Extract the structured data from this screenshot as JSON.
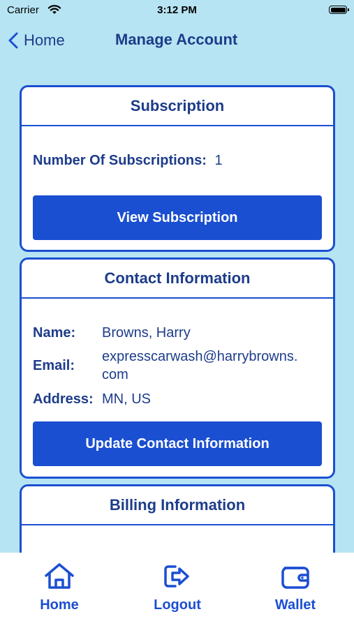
{
  "status_bar": {
    "carrier": "Carrier",
    "time": "3:12 PM"
  },
  "nav": {
    "back_label": "Home",
    "title": "Manage Account"
  },
  "subscription": {
    "title": "Subscription",
    "count_label": "Number Of Subscriptions:",
    "count_value": "1",
    "button_label": "View Subscription"
  },
  "contact": {
    "title": "Contact Information",
    "name_label": "Name:",
    "name_value": "Browns, Harry",
    "email_label": "Email:",
    "email_value_line1": "expresscarwash@harrybrowns.",
    "email_value_line2": "com",
    "address_label": "Address:",
    "address_value": "MN, US",
    "button_label": "Update Contact Information"
  },
  "billing": {
    "title": "Billing Information"
  },
  "tabs": [
    {
      "label": "Home",
      "icon": "home-icon"
    },
    {
      "label": "Logout",
      "icon": "logout-icon"
    },
    {
      "label": "Wallet",
      "icon": "wallet-icon"
    }
  ],
  "colors": {
    "background": "#b7e4f3",
    "accent": "#1b4fd1",
    "text": "#1d3c8a"
  }
}
